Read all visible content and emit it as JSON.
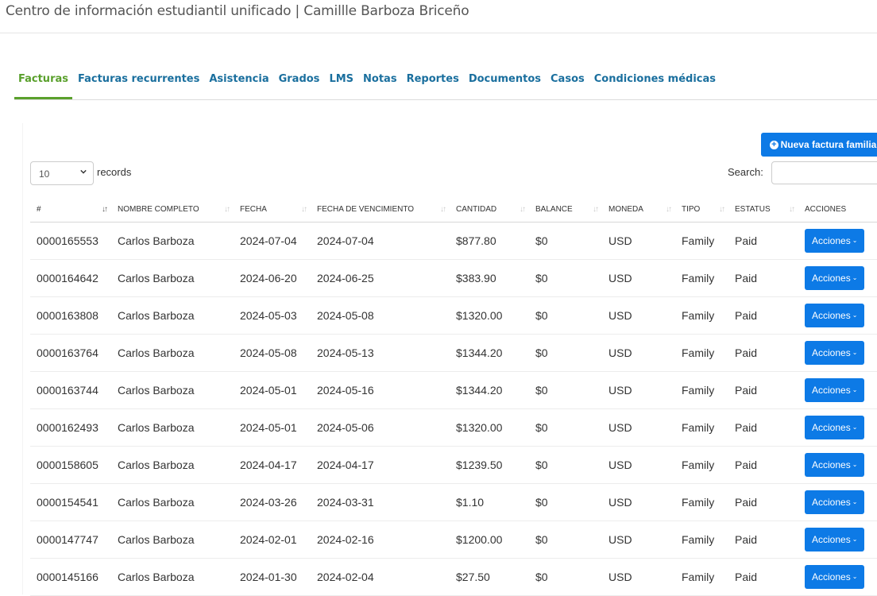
{
  "header": {
    "title": "Centro de información estudiantil unificado | Camillle Barboza Briceño"
  },
  "tabs": [
    {
      "label": "Facturas",
      "active": true
    },
    {
      "label": "Facturas recurrentes"
    },
    {
      "label": "Asistencia"
    },
    {
      "label": "Grados"
    },
    {
      "label": "LMS"
    },
    {
      "label": "Notas"
    },
    {
      "label": "Reportes"
    },
    {
      "label": "Documentos"
    },
    {
      "label": "Casos"
    },
    {
      "label": "Condiciones médicas"
    }
  ],
  "toolbar": {
    "new_invoice_label": "Nueva factura familiar",
    "page_length": "10",
    "records_label": "records",
    "search_label": "Search:",
    "search_value": ""
  },
  "table": {
    "columns": [
      "#",
      "NOMBRE COMPLETO",
      "FECHA",
      "FECHA DE VENCIMIENTO",
      "CANTIDAD",
      "BALANCE",
      "MONEDA",
      "TIPO",
      "ESTATUS",
      "ACCIONES"
    ],
    "action_label": "Acciones",
    "rows": [
      [
        "0000165553",
        "Carlos Barboza",
        "2024-07-04",
        "2024-07-04",
        "$877.80",
        "$0",
        "USD",
        "Family",
        "Paid"
      ],
      [
        "0000164642",
        "Carlos Barboza",
        "2024-06-20",
        "2024-06-25",
        "$383.90",
        "$0",
        "USD",
        "Family",
        "Paid"
      ],
      [
        "0000163808",
        "Carlos Barboza",
        "2024-05-03",
        "2024-05-08",
        "$1320.00",
        "$0",
        "USD",
        "Family",
        "Paid"
      ],
      [
        "0000163764",
        "Carlos Barboza",
        "2024-05-08",
        "2024-05-13",
        "$1344.20",
        "$0",
        "USD",
        "Family",
        "Paid"
      ],
      [
        "0000163744",
        "Carlos Barboza",
        "2024-05-01",
        "2024-05-16",
        "$1344.20",
        "$0",
        "USD",
        "Family",
        "Paid"
      ],
      [
        "0000162493",
        "Carlos Barboza",
        "2024-05-01",
        "2024-05-06",
        "$1320.00",
        "$0",
        "USD",
        "Family",
        "Paid"
      ],
      [
        "0000158605",
        "Carlos Barboza",
        "2024-04-17",
        "2024-04-17",
        "$1239.50",
        "$0",
        "USD",
        "Family",
        "Paid"
      ],
      [
        "0000154541",
        "Carlos Barboza",
        "2024-03-26",
        "2024-03-31",
        "$1.10",
        "$0",
        "USD",
        "Family",
        "Paid"
      ],
      [
        "0000147747",
        "Carlos Barboza",
        "2024-02-01",
        "2024-02-16",
        "$1200.00",
        "$0",
        "USD",
        "Family",
        "Paid"
      ],
      [
        "0000145166",
        "Carlos Barboza",
        "2024-01-30",
        "2024-02-04",
        "$27.50",
        "$0",
        "USD",
        "Family",
        "Paid"
      ]
    ]
  },
  "colors": {
    "link": "#1a6f9e",
    "active_tab": "#5aa02c",
    "primary_button": "#0d7ae6"
  }
}
